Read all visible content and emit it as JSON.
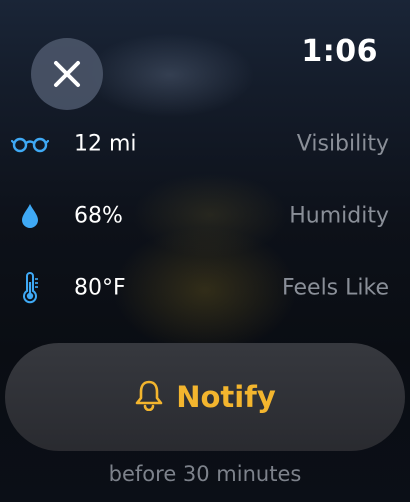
{
  "status_bar": {
    "time": "1:06"
  },
  "close_button": {
    "icon": "close-icon"
  },
  "details": [
    {
      "icon": "glasses-icon",
      "value": "12 mi",
      "label": "Visibility"
    },
    {
      "icon": "water-drop-icon",
      "value": "68%",
      "label": "Humidity"
    },
    {
      "icon": "thermometer-icon",
      "value": "80°F",
      "label": "Feels Like"
    }
  ],
  "notify": {
    "icon": "bell-icon",
    "label": "Notify"
  },
  "footer": {
    "text": "before 30 minutes"
  },
  "colors": {
    "accent": "#f3b52e",
    "icon_blue": "#3fa9f5",
    "label_gray": "#8a8f98"
  }
}
